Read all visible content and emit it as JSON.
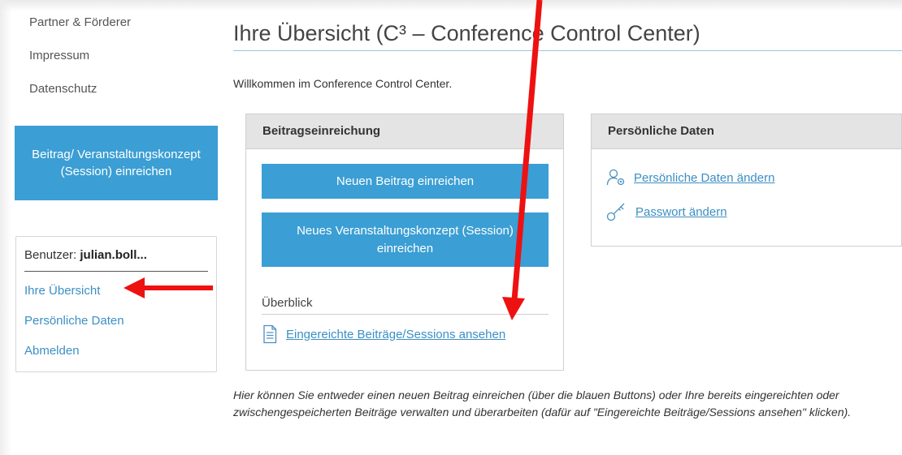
{
  "sidebar": {
    "links": [
      "Partner & Förderer",
      "Impressum",
      "Datenschutz"
    ],
    "submit_button": "Beitrag/ Veranstaltungskonzept (Session) einreichen",
    "user_prefix": "Benutzer:",
    "user_name": "julian.boll...",
    "menu": [
      "Ihre Übersicht",
      "Persönliche Daten",
      "Abmelden"
    ]
  },
  "main": {
    "title": "Ihre Übersicht (C³ – Conference Control Center)",
    "welcome": "Willkommen im Conference Control Center.",
    "submission_panel": {
      "heading": "Beitragseinreichung",
      "new_contribution_button": "Neuen Beitrag einreichen",
      "new_session_button": "Neues Veranstaltungskonzept (Session) einreichen",
      "overview_label": "Überblick",
      "view_link": "Eingereichte Beiträge/Sessions ansehen"
    },
    "personal_panel": {
      "heading": "Persönliche Daten",
      "change_data_link": "Persönliche Daten ändern",
      "change_password_link": "Passwort ändern"
    },
    "help_text": "Hier können Sie entweder einen neuen Beitrag einreichen (über die blauen Buttons) oder Ihre bereits eingereichten oder zwischengespeicherten Beiträge verwalten und überarbeiten (dafür auf \"Eingereichte Beiträge/Sessions ansehen\" klicken)."
  },
  "icons": {
    "document": "document-icon",
    "user_settings": "user-settings-icon",
    "key": "key-icon"
  },
  "colors": {
    "primary_button": "#3b9ed4",
    "link": "#3b8fc4",
    "panel_header": "#e4e4e4",
    "annotation_arrow": "#ee1111"
  }
}
